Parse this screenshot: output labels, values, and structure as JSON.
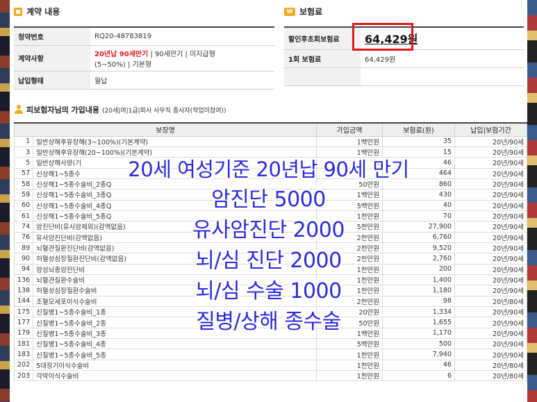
{
  "contract": {
    "section_title": "계약 내용",
    "rows": [
      {
        "label": "청약번호",
        "value": "RQ20-48783819"
      },
      {
        "label": "계약사항",
        "value_red": "20년납 90세만기",
        "value_rest": " | 90세만기 | 미지급형",
        "value_line2": "(5~50%) | 기본형"
      },
      {
        "label": "납입형태",
        "value": "월납"
      }
    ]
  },
  "premium": {
    "section_title": "보험료",
    "icon_text": "W",
    "discount_label": "할인후초회보험료",
    "discount_value": "64,429원",
    "first_label": "1회 보험료",
    "first_value": "64,429원"
  },
  "coverage": {
    "title": "피보험자님의 가입내용",
    "subtitle": "(20세|여|1급|회사 사무직 종사자(작업미참여))",
    "headers": [
      "보장명",
      "가입금액",
      "보험료(원)",
      "납입|보험기간"
    ],
    "rows": [
      {
        "code": "1",
        "name": "일반상해후유장해(3~100%)(기본계약)",
        "amount": "1백만원",
        "premium": "35",
        "period": "20년/90세"
      },
      {
        "code": "3",
        "name": "일반상해후유장해(20~100%)(기본계약)",
        "amount": "1백만원",
        "premium": "15",
        "period": "20년/90세"
      },
      {
        "code": "5",
        "name": "일반상해사망(기",
        "amount": "1",
        "premium": "46",
        "period": "20년/90세"
      },
      {
        "code": "57",
        "name": "신상해1~5종수",
        "amount": "0",
        "premium": "464",
        "period": "20년/90세"
      },
      {
        "code": "58",
        "name": "신상해1~5종수술비_2종Q",
        "amount": "50만원",
        "premium": "860",
        "period": "20년/90세"
      },
      {
        "code": "59",
        "name": "신상해1~5종수술비_3종Q",
        "amount": "1백만원",
        "premium": "430",
        "period": "20년/90세"
      },
      {
        "code": "60",
        "name": "신상해1~5종수술비_4종Q",
        "amount": "5백만원",
        "premium": "40",
        "period": "20년/90세"
      },
      {
        "code": "61",
        "name": "신상해1~5종수술비_5종Q",
        "amount": "1천만원",
        "premium": "70",
        "period": "20년/90세"
      },
      {
        "code": "74",
        "name": "암진단비(유사암제외)(감액없음)",
        "amount": "5천만원",
        "premium": "27,900",
        "period": "20년/90세"
      },
      {
        "code": "76",
        "name": "유사암진단비(감액없음)",
        "amount": "2천만원",
        "premium": "6,760",
        "period": "20년/90세"
      },
      {
        "code": "89",
        "name": "뇌혈관질환진단비(감액없음)",
        "amount": "2천만원",
        "premium": "9,520",
        "period": "20년/90세"
      },
      {
        "code": "90",
        "name": "허혈성심장질환진단비(감액없음)",
        "amount": "2천만원",
        "premium": "2,760",
        "period": "20년/90세"
      },
      {
        "code": "94",
        "name": "양성뇌종양진단비",
        "amount": "1천만원",
        "premium": "200",
        "period": "20년/90세"
      },
      {
        "code": "136",
        "name": "뇌혈관질환수술비",
        "amount": "1천만원",
        "premium": "1,400",
        "period": "20년/90세"
      },
      {
        "code": "138",
        "name": "허혈성심장질환수술비",
        "amount": "1천만원",
        "premium": "1,180",
        "period": "20년/90세"
      },
      {
        "code": "144",
        "name": "조혈모세포이식수술비",
        "amount": "2천만원",
        "premium": "98",
        "period": "20년/80세"
      },
      {
        "code": "175",
        "name": "신질병1~5종수술비_1종",
        "amount": "20만원",
        "premium": "1,334",
        "period": "20년/90세"
      },
      {
        "code": "177",
        "name": "신질병1~5종수술비_2종",
        "amount": "50만원",
        "premium": "1,655",
        "period": "20년/90세"
      },
      {
        "code": "179",
        "name": "신질병1~5종수술비_3종",
        "amount": "1백만원",
        "premium": "1,170",
        "period": "20년/90세"
      },
      {
        "code": "181",
        "name": "신질병1~5종수술비_4종",
        "amount": "5백만원",
        "premium": "500",
        "period": "20년/90세"
      },
      {
        "code": "183",
        "name": "신질병1~5종수술비_5종",
        "amount": "1천만원",
        "premium": "7,940",
        "period": "20년/90세"
      },
      {
        "code": "202",
        "name": "5대장기이식수술비",
        "amount": "1천만원",
        "premium": "46",
        "period": "20년/80세"
      },
      {
        "code": "203",
        "name": "각막이식수술비",
        "amount": "1천만원",
        "premium": "6",
        "period": "20년/80세"
      }
    ]
  },
  "overlay": {
    "lines": [
      "20세 여성기준 20년납 90세 만기",
      "암진단 5000",
      "유사암진단 2000",
      "뇌/심 진단 2000",
      "뇌/심 수술 1000",
      "질병/상해 종수술"
    ],
    "color": "#2a2bd9"
  },
  "highlight_color": "#e01818"
}
